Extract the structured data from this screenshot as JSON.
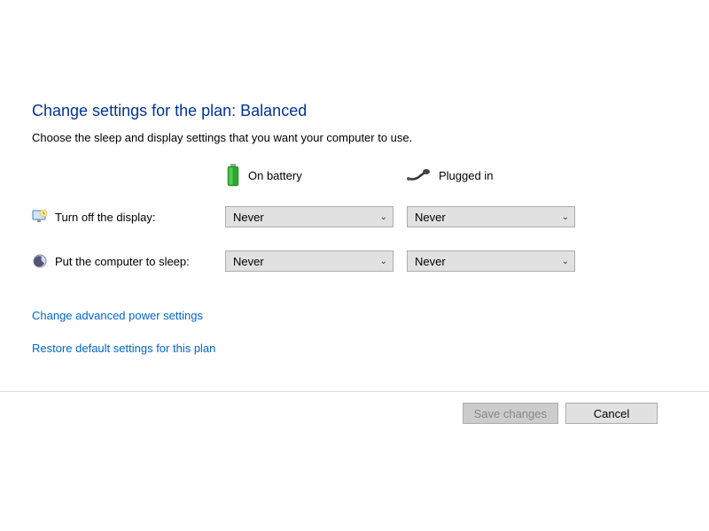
{
  "title": "Change settings for the plan: Balanced",
  "subtitle": "Choose the sleep and display settings that you want your computer to use.",
  "columns": {
    "battery": "On battery",
    "plugged": "Plugged in"
  },
  "rows": {
    "display": {
      "label": "Turn off the display:",
      "battery": "Never",
      "plugged": "Never"
    },
    "sleep": {
      "label": "Put the computer to sleep:",
      "battery": "Never",
      "plugged": "Never"
    }
  },
  "links": {
    "advanced": "Change advanced power settings",
    "restore": "Restore default settings for this plan"
  },
  "buttons": {
    "save": "Save changes",
    "cancel": "Cancel"
  }
}
